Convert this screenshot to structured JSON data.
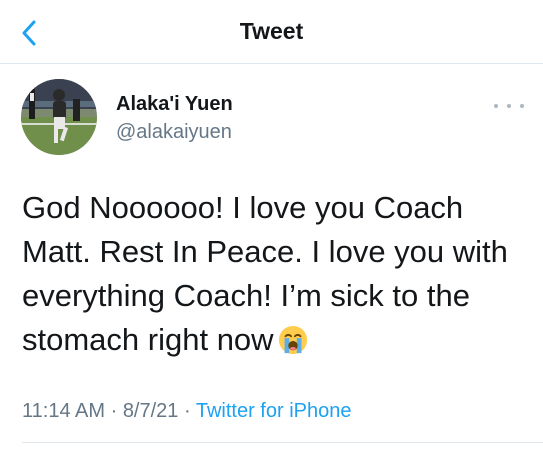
{
  "nav": {
    "title": "Tweet",
    "back_icon": "chevron-left-icon"
  },
  "author": {
    "name": "Alaka'i Yuen",
    "handle": "@alakaiyuen"
  },
  "tweet": {
    "text": "God Noooooo! I love you Coach Matt. Rest In Peace. I love you with everything Coach! I’m sick to the stomach right now",
    "emoji": "loudly-crying-face-icon"
  },
  "meta": {
    "time": "11:14 AM",
    "sep1": " · ",
    "date": "8/7/21",
    "sep2": " · ",
    "source": "Twitter for iPhone"
  },
  "colors": {
    "accent": "#1da1f2",
    "secondary": "#657786",
    "divider": "#e1e8ed"
  }
}
